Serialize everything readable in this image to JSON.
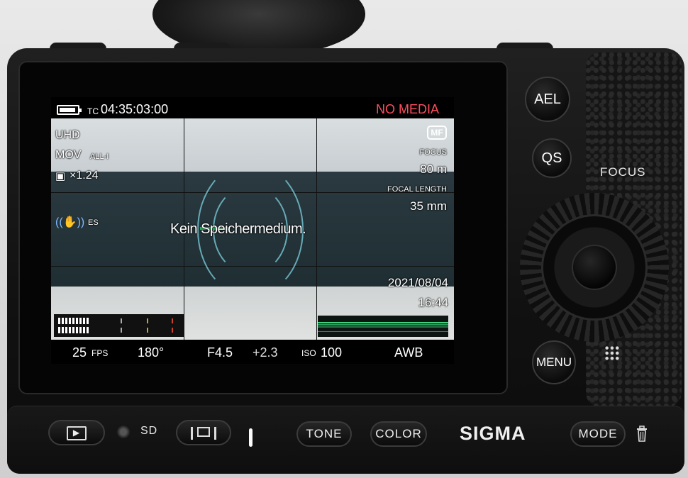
{
  "screen": {
    "timecode_prefix": "TC",
    "timecode": "04:35:03:00",
    "media_status": "NO MEDIA",
    "media_status_color": "#ff4d5e",
    "battery_level": 0.9,
    "resolution": "UHD",
    "file_format": "MOV",
    "compression": "ALL-I",
    "crop_factor": "×1.24",
    "stabilizer_mode": "ES",
    "focus_mode": "MF",
    "focus_label": "FOCUS",
    "focus_distance": "80 m",
    "focal_length_label": "FOCAL LENGTH",
    "focal_length": "35 mm",
    "message": "Kein Speichermedium.",
    "date": "2021/08/04",
    "time": "16:44",
    "frame_rate_value": "25",
    "frame_rate_unit": "FPS",
    "shutter_angle": "180°",
    "aperture": "F4.5",
    "exposure_comp": "+2.3",
    "iso_label": "ISO",
    "iso_value": "100",
    "white_balance": "AWB",
    "audio_meter_levels": [
      0.25,
      0.25
    ]
  },
  "hardware": {
    "ael_label": "AEL",
    "qs_label": "QS",
    "focus_label": "FOCUS",
    "menu_label": "MENU",
    "sd_label": "SD",
    "tone_label": "TONE",
    "color_label": "COLOR",
    "brand": "SIGMA",
    "mode_label": "MODE"
  }
}
